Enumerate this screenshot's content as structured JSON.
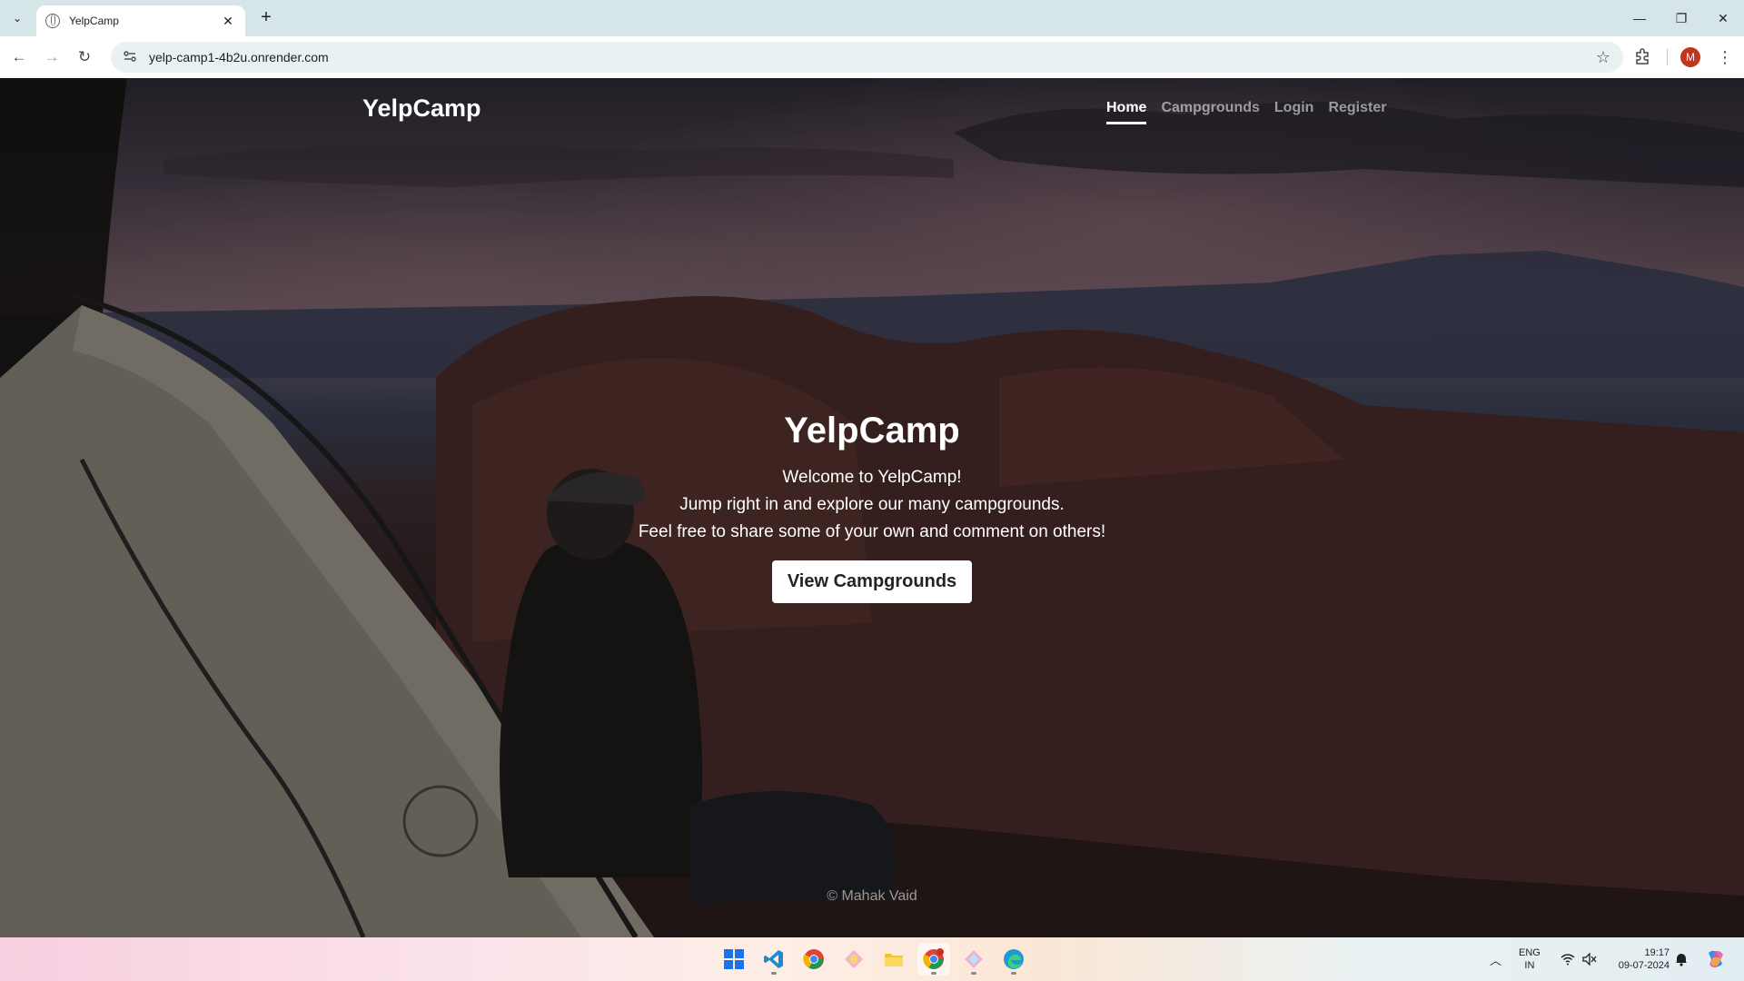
{
  "browser": {
    "tab_title": "YelpCamp",
    "url": "yelp-camp1-4b2u.onrender.com",
    "profile_initial": "M"
  },
  "site": {
    "brand": "YelpCamp",
    "nav": [
      {
        "label": "Home",
        "active": true
      },
      {
        "label": "Campgrounds",
        "active": false
      },
      {
        "label": "Login",
        "active": false
      },
      {
        "label": "Register",
        "active": false
      }
    ]
  },
  "hero": {
    "title": "YelpCamp",
    "line1": "Welcome to YelpCamp!",
    "line2": "Jump right in and explore our many campgrounds.",
    "line3": "Feel free to share some of your own and comment on others!",
    "button": "View Campgrounds"
  },
  "footer": {
    "text": "© Mahak Vaid"
  },
  "taskbar": {
    "apps": [
      "windows-start",
      "vscode",
      "chrome",
      "gitkraken",
      "file-explorer",
      "chrome-profile",
      "gitkraken-2",
      "edge"
    ],
    "lang_top": "ENG",
    "lang_bottom": "IN",
    "time": "19:17",
    "date": "09-07-2024"
  },
  "colors": {
    "tabbar_bg": "#d6e6e8",
    "profile_bg": "#c4341e",
    "hero_button_bg": "#ffffff",
    "nav_inactive": "rgba(255,255,255,0.55)"
  }
}
